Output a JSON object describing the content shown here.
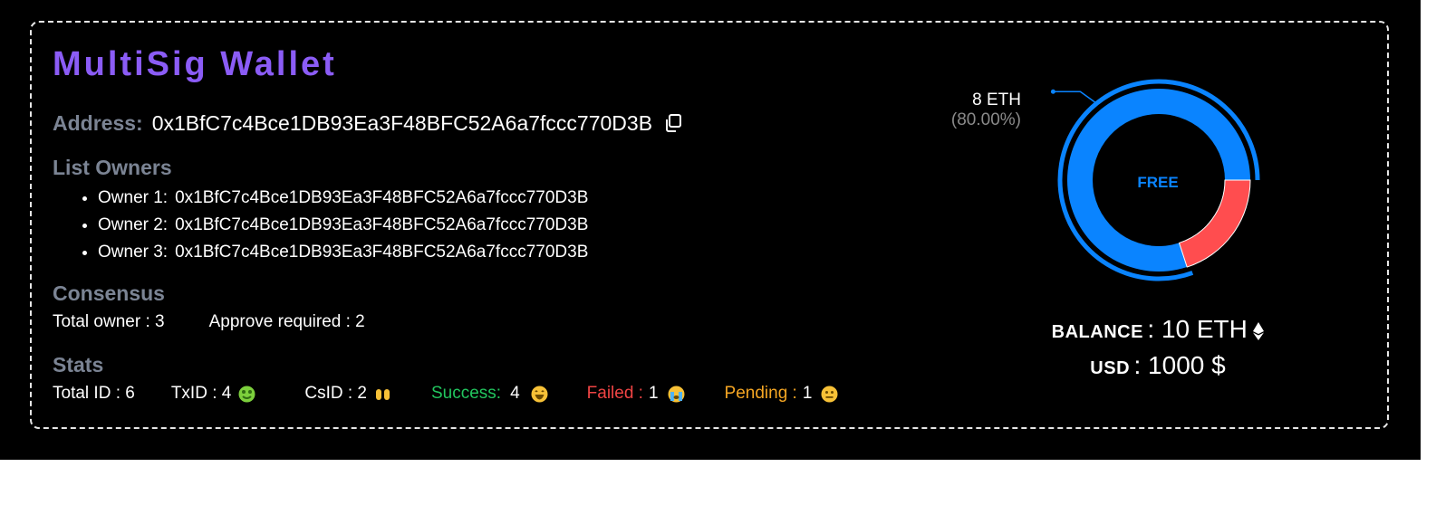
{
  "wallet": {
    "title": "MultiSig Wallet",
    "address_label": "Address:",
    "address": "0x1BfC7c4Bce1DB93Ea3F48BFC52A6a7fccc770D3B"
  },
  "owners": {
    "heading": "List Owners",
    "items": [
      {
        "label": "Owner 1:",
        "address": "0x1BfC7c4Bce1DB93Ea3F48BFC52A6a7fccc770D3B"
      },
      {
        "label": "Owner 2:",
        "address": "0x1BfC7c4Bce1DB93Ea3F48BFC52A6a7fccc770D3B"
      },
      {
        "label": "Owner 3:",
        "address": "0x1BfC7c4Bce1DB93Ea3F48BFC52A6a7fccc770D3B"
      }
    ]
  },
  "consensus": {
    "heading": "Consensus",
    "total_owner": "Total owner : 3",
    "approve_required": "Approve required : 2"
  },
  "stats": {
    "heading": "Stats",
    "total_id": "Total ID : 6",
    "txid": "TxID : 4",
    "txid_icon": "money-mouth-face-icon",
    "csid": "CsID : 2",
    "csid_icon": "open-hands-icon",
    "success_label": "Success:",
    "success_value": "4",
    "success_icon": "grinning-face-icon",
    "failed_label": "Failed :",
    "failed_value": "1",
    "failed_icon": "crying-face-icon",
    "pending_label": "Pending :",
    "pending_value": "1",
    "pending_icon": "neutral-face-icon"
  },
  "donut": {
    "center_label": "FREE",
    "callout_value": "8 ETH",
    "callout_percent": "(80.00%)",
    "free_fraction": 0.8,
    "used_fraction": 0.2,
    "colors": {
      "free": "#0a84ff",
      "used": "#ff4d4f"
    }
  },
  "balance": {
    "balance_key": "BALANCE",
    "balance_value": ": 10 ETH",
    "eth_icon": "ethereum-icon",
    "usd_key": "USD",
    "usd_value": ": 1000 $"
  },
  "colors": {
    "accent": "#8b5cf6",
    "muted_heading": "#7b8494",
    "success": "#22c55e",
    "failed": "#ef4444",
    "pending": "#f5a623"
  }
}
